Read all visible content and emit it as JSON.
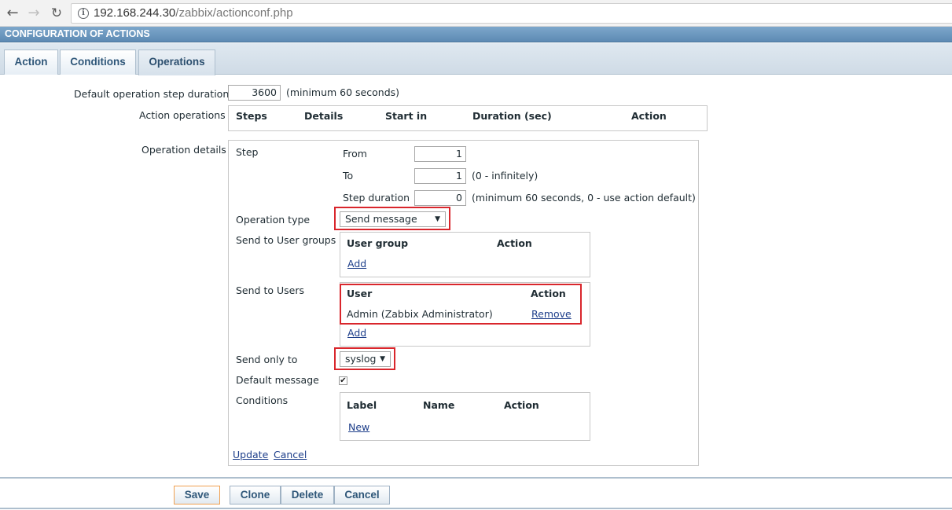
{
  "browser": {
    "url_host": "192.168.244.30",
    "url_path": "/zabbix/actionconf.php"
  },
  "header": {
    "title": "CONFIGURATION OF ACTIONS"
  },
  "tabs": [
    {
      "label": "Action"
    },
    {
      "label": "Conditions"
    },
    {
      "label": "Operations",
      "active": true
    }
  ],
  "form": {
    "default_step_duration_label": "Default operation step duration",
    "default_step_duration_value": "3600",
    "default_step_duration_hint": "(minimum 60 seconds)",
    "action_operations_label": "Action operations",
    "action_operations_columns": [
      "Steps",
      "Details",
      "Start in",
      "Duration (sec)",
      "Action"
    ],
    "operation_details_label": "Operation details"
  },
  "details": {
    "step_label": "Step",
    "from_label": "From",
    "from_value": "1",
    "to_label": "To",
    "to_value": "1",
    "to_hint": "(0 - infinitely)",
    "step_duration_label": "Step duration",
    "step_duration_value": "0",
    "step_duration_hint": "(minimum 60 seconds, 0 - use action default)",
    "operation_type_label": "Operation type",
    "operation_type_value": "Send message",
    "send_user_groups_label": "Send to User groups",
    "user_groups_col_group": "User group",
    "user_groups_col_action": "Action",
    "user_groups_add": "Add",
    "send_users_label": "Send to Users",
    "users_col_user": "User",
    "users_col_action": "Action",
    "users": [
      {
        "name": "Admin (Zabbix Administrator)",
        "action": "Remove"
      }
    ],
    "users_add": "Add",
    "send_only_to_label": "Send only to",
    "send_only_to_value": "syslog",
    "default_message_label": "Default message",
    "default_message_checked": true,
    "conditions_label": "Conditions",
    "conditions_col_label": "Label",
    "conditions_col_name": "Name",
    "conditions_col_action": "Action",
    "conditions_new": "New",
    "update_link": "Update",
    "cancel_link": "Cancel"
  },
  "buttons": {
    "save": "Save",
    "clone": "Clone",
    "delete": "Delete",
    "cancel": "Cancel"
  },
  "colors": {
    "highlight": "#d9262c",
    "header_blue": "#6a94bb",
    "link": "#1d3e8a"
  }
}
